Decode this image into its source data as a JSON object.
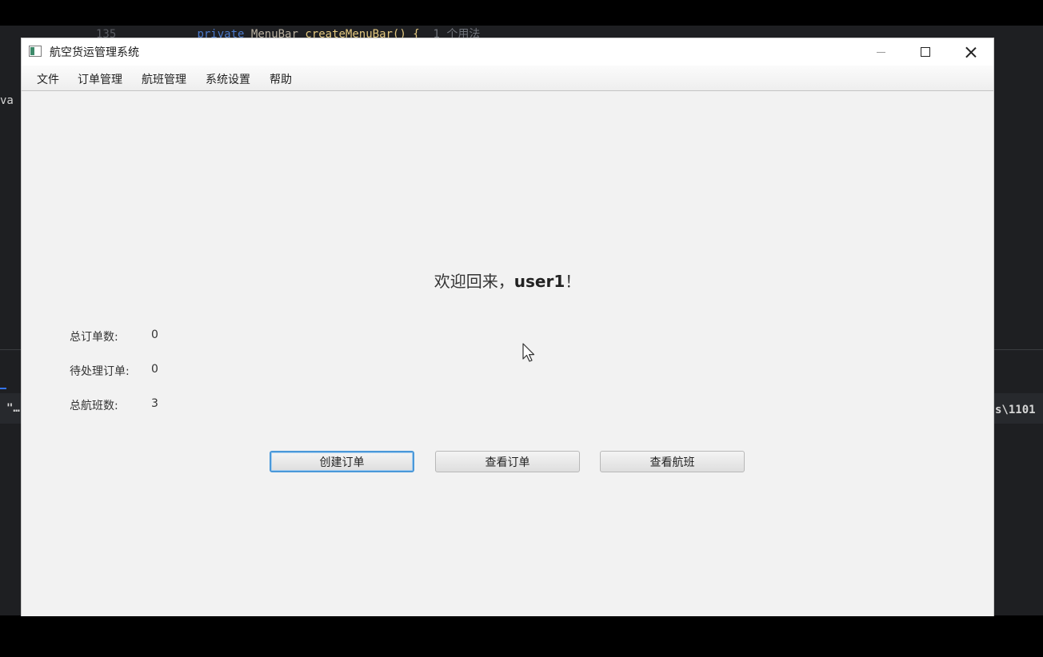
{
  "ide": {
    "line_number": "135",
    "code_keyword": "private",
    "code_type": "MenuBar",
    "code_function": "createMenuBar() {",
    "code_hint": "1 个用法",
    "left_fragment": "va",
    "left_fragment2": "\"…",
    "right_fragment": "s\\1101"
  },
  "window": {
    "title": "航空货运管理系统",
    "icon": "java-app-icon"
  },
  "menu": {
    "items": [
      "文件",
      "订单管理",
      "航班管理",
      "系统设置",
      "帮助"
    ]
  },
  "welcome": {
    "prefix": "欢迎回来，",
    "username": "user1",
    "suffix": "！"
  },
  "stats": [
    {
      "label": "总订单数:",
      "value": "0"
    },
    {
      "label": "待处理订单:",
      "value": "0"
    },
    {
      "label": "总航班数:",
      "value": "3"
    }
  ],
  "buttons": {
    "create_order": "创建订单",
    "view_orders": "查看订单",
    "view_flights": "查看航班"
  },
  "colors": {
    "window_bg": "#f2f2f2",
    "focus_ring": "#4a98d9",
    "ide_bg": "#1e1f22"
  }
}
